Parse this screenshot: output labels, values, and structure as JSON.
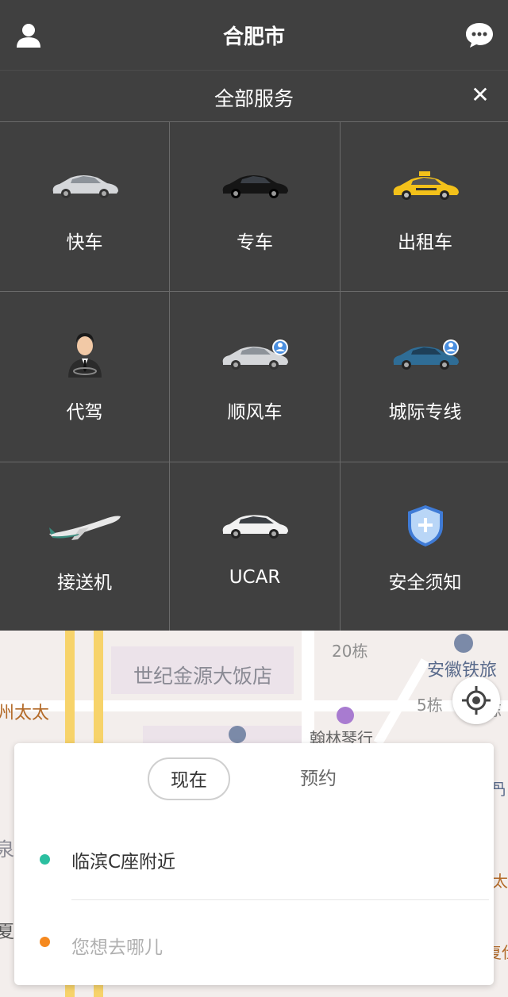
{
  "header": {
    "city": "合肥市"
  },
  "services_bar": {
    "title": "全部服务",
    "close_symbol": "✕"
  },
  "services": [
    {
      "label": "快车",
      "icon": "silver-car-icon"
    },
    {
      "label": "专车",
      "icon": "black-car-icon"
    },
    {
      "label": "出租车",
      "icon": "taxi-icon"
    },
    {
      "label": "代驾",
      "icon": "driver-person-icon"
    },
    {
      "label": "顺风车",
      "icon": "carpool-car-icon"
    },
    {
      "label": "城际专线",
      "icon": "intercity-car-icon"
    },
    {
      "label": "接送机",
      "icon": "airplane-icon"
    },
    {
      "label": "UCAR",
      "icon": "white-hatchback-icon"
    },
    {
      "label": "安全须知",
      "icon": "shield-icon"
    }
  ],
  "map": {
    "labels": [
      "世纪金源大饭店",
      "州太太",
      "安徽铁旅",
      "翰林琴行",
      "泉",
      "夏"
    ],
    "buildings": [
      "20栋",
      "5栋",
      "栋",
      "冎",
      "太",
      "复仕"
    ]
  },
  "trip_panel": {
    "tab_now": "现在",
    "tab_book": "预约",
    "from": "临滨C座附近",
    "to_placeholder": "您想去哪儿",
    "colors": {
      "from_dot": "#2bbfa0",
      "to_dot": "#f5891f"
    }
  }
}
